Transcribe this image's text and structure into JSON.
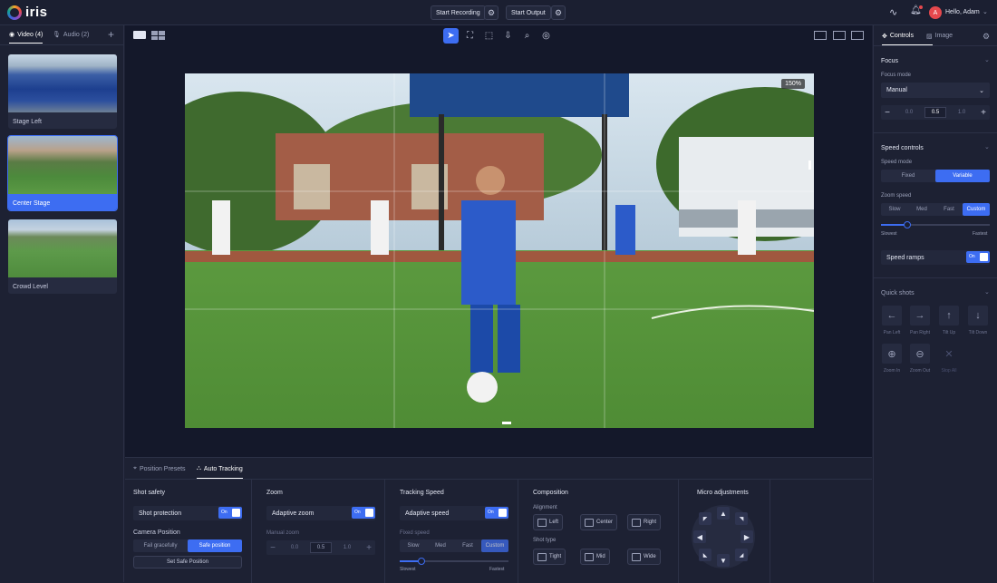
{
  "app": {
    "name": "iris"
  },
  "topbar": {
    "start_recording": "Start Recording",
    "start_output": "Start Output",
    "greeting": "Hello, Adam",
    "avatar_initial": "A"
  },
  "left": {
    "tab_video": "Video (4)",
    "tab_audio": "Audio (2)",
    "sources": [
      {
        "label": "Stage Left"
      },
      {
        "label": "Center Stage"
      },
      {
        "label": "Crowd Level"
      }
    ]
  },
  "viewer": {
    "zoom": "150%"
  },
  "bottom": {
    "tab_presets": "Position Presets",
    "tab_tracking": "Auto Tracking",
    "shot_safety": {
      "title": "Shot safety",
      "shot_protection": "Shot protection",
      "toggle": "On",
      "camera_position": "Camera Position",
      "opt1": "Fail gracefully",
      "opt2": "Safe position",
      "set_btn": "Set Safe Position"
    },
    "zoom": {
      "title": "Zoom",
      "adaptive": "Adaptive zoom",
      "toggle": "On",
      "manual": "Manual zoom",
      "v0": "0.0",
      "v1": "0.5",
      "v2": "1.0"
    },
    "tracking": {
      "title": "Tracking Speed",
      "adaptive": "Adaptive speed",
      "toggle": "On",
      "fixed": "Fixed speed",
      "opts": [
        "Slow",
        "Med",
        "Fast",
        "Custom"
      ],
      "slowest": "Slowest",
      "fastest": "Fastest",
      "slider_fraction": 0.2
    },
    "composition": {
      "title": "Composition",
      "alignment": "Alignment",
      "align_opts": [
        "Left",
        "Center",
        "Right"
      ],
      "shot_type": "Shot type",
      "shot_opts": [
        "Tight",
        "Mid",
        "Wide"
      ]
    },
    "micro": {
      "title": "Micro adjustments"
    }
  },
  "right": {
    "tab_controls": "Controls",
    "tab_image": "Image",
    "focus": {
      "title": "Focus",
      "mode_label": "Focus mode",
      "mode_value": "Manual",
      "v0": "0.0",
      "v1": "0.5",
      "v2": "1.0"
    },
    "speed": {
      "title": "Speed controls",
      "mode_label": "Speed mode",
      "mode_opts": [
        "Fixed",
        "Variable"
      ],
      "zoom_label": "Zoom speed",
      "zoom_opts": [
        "Slow",
        "Med",
        "Fast",
        "Custom"
      ],
      "slowest": "Slowest",
      "fastest": "Fastest",
      "slider_fraction": 0.24,
      "ramps": "Speed ramps",
      "toggle": "On"
    },
    "quick": {
      "title": "Quick shots",
      "items": [
        "Pan Left",
        "Pan Right",
        "Tilt Up",
        "Tilt Down",
        "Zoom In",
        "Zoom Out",
        "Stop All"
      ]
    }
  },
  "colors": {
    "accent": "#3d6df2",
    "bg": "#1d2133",
    "panel": "#262b40"
  }
}
